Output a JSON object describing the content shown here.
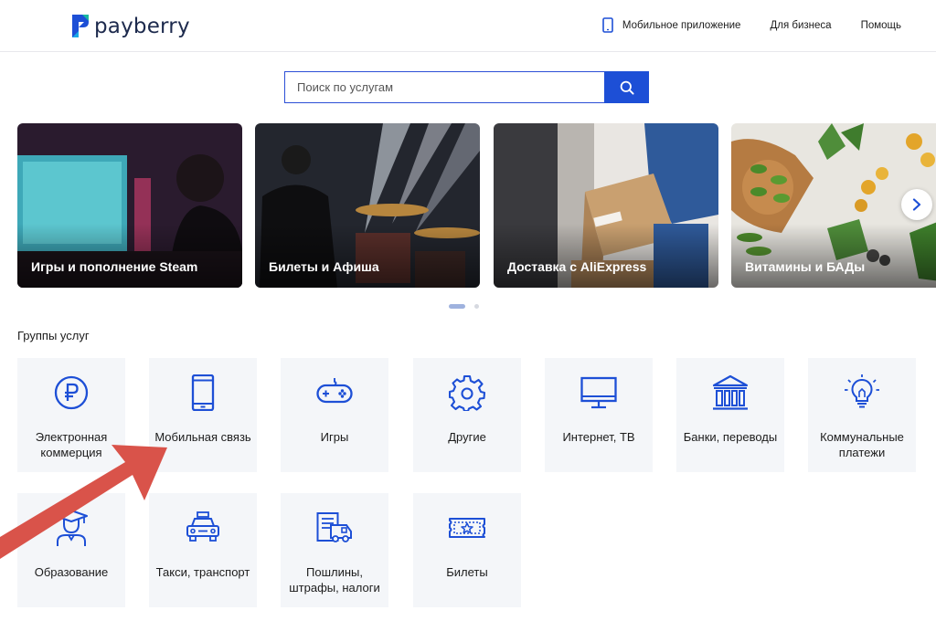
{
  "brand": {
    "name": "payberry",
    "logo_color": "#1d4fd6"
  },
  "nav": {
    "mobile_app": "Мобильное приложение",
    "business": "Для бизнеса",
    "help": "Помощь"
  },
  "search": {
    "placeholder": "Поиск по услугам",
    "value": ""
  },
  "banners": [
    {
      "label": "Игры и пополнение Steam"
    },
    {
      "label": "Билеты и Афиша"
    },
    {
      "label": "Доставка с AliExpress"
    },
    {
      "label": "Витамины и БАДы"
    }
  ],
  "carousel": {
    "page_count": 2,
    "active_page": 1
  },
  "groups": {
    "title": "Группы услуг",
    "items": [
      {
        "name": "Электронная коммерция",
        "icon": "ruble-icon"
      },
      {
        "name": "Мобильная связь",
        "icon": "smartphone-icon"
      },
      {
        "name": "Игры",
        "icon": "gamepad-icon"
      },
      {
        "name": "Другие",
        "icon": "gear-icon"
      },
      {
        "name": "Интернет, ТВ",
        "icon": "monitor-icon"
      },
      {
        "name": "Банки, переводы",
        "icon": "bank-icon"
      },
      {
        "name": "Коммунальные платежи",
        "icon": "lightbulb-icon"
      },
      {
        "name": "Образование",
        "icon": "graduate-icon"
      },
      {
        "name": "Такси, транспорт",
        "icon": "taxi-icon"
      },
      {
        "name": "Пошлины, штрафы, налоги",
        "icon": "document-truck-icon"
      },
      {
        "name": "Билеты",
        "icon": "ticket-icon"
      }
    ]
  },
  "colors": {
    "accent": "#1d4fd6",
    "annotation_arrow": "#d9534a",
    "tile_bg": "#f4f6f9"
  }
}
